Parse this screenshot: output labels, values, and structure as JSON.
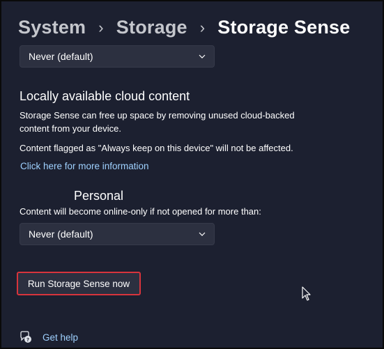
{
  "breadcrumb": {
    "items": [
      "System",
      "Storage"
    ],
    "current": "Storage Sense",
    "separator": "›"
  },
  "top_dropdown": {
    "value": "Never (default)"
  },
  "cloud_section": {
    "title": "Locally available cloud content",
    "description_line1": "Storage Sense can free up space by removing unused cloud-backed",
    "description_line2": "content from your device.",
    "note": "Content flagged as \"Always keep on this device\" will not be affected.",
    "link": "Click here for more information"
  },
  "personal_section": {
    "title": "Personal",
    "description": "Content will become online-only if not opened for more than:",
    "dropdown_value": "Never (default)"
  },
  "run_button": {
    "label": "Run Storage Sense now"
  },
  "help": {
    "label": "Get help"
  },
  "colors": {
    "background": "#1c2030",
    "accent_link": "#9fd1ff",
    "highlight_border": "#d8343c"
  }
}
